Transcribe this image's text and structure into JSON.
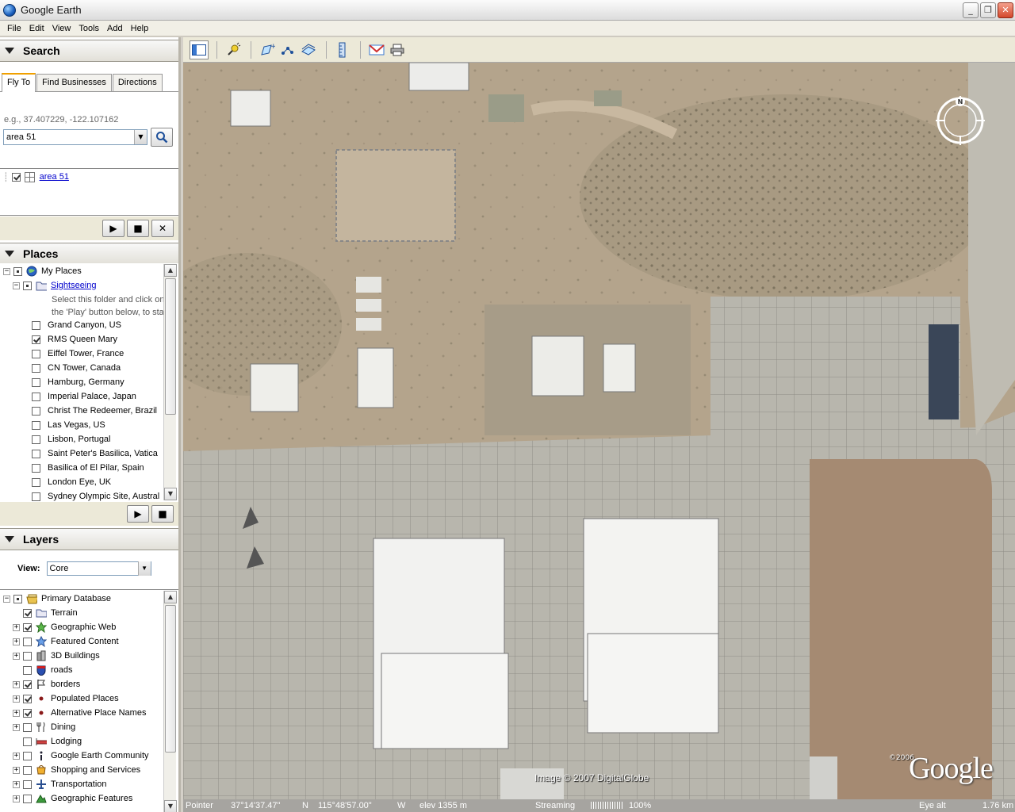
{
  "window": {
    "title": "Google Earth"
  },
  "menu": [
    "File",
    "Edit",
    "View",
    "Tools",
    "Add",
    "Help"
  ],
  "search": {
    "header": "Search",
    "tabs": [
      "Fly To",
      "Find Businesses",
      "Directions"
    ],
    "hint": "e.g., 37.407229, -122.107162",
    "query": "area 51",
    "result": "area 51"
  },
  "places": {
    "header": "Places",
    "root": "My Places",
    "folder": "Sightseeing",
    "folder_desc_1": "Select this folder and click on",
    "folder_desc_2": "the 'Play' button below, to sta",
    "items": [
      {
        "label": "Grand Canyon, US",
        "checked": false
      },
      {
        "label": "RMS Queen Mary",
        "checked": true
      },
      {
        "label": "Eiffel Tower, France",
        "checked": false
      },
      {
        "label": "CN Tower, Canada",
        "checked": false
      },
      {
        "label": "Hamburg, Germany",
        "checked": false
      },
      {
        "label": "Imperial Palace, Japan",
        "checked": false
      },
      {
        "label": "Christ The Redeemer, Brazil",
        "checked": false
      },
      {
        "label": "Las Vegas, US",
        "checked": false
      },
      {
        "label": "Lisbon, Portugal",
        "checked": false
      },
      {
        "label": "Saint Peter's Basilica, Vatica",
        "checked": false
      },
      {
        "label": "Basilica of El Pilar, Spain",
        "checked": false
      },
      {
        "label": "London Eye, UK",
        "checked": false
      },
      {
        "label": "Sydney Olympic Site, Austral",
        "checked": false
      }
    ]
  },
  "layers": {
    "header": "Layers",
    "view_label": "View:",
    "view_value": "Core",
    "root": "Primary Database",
    "items": [
      {
        "label": "Terrain",
        "checked": true,
        "expandable": false,
        "icon": "folder-icon"
      },
      {
        "label": "Geographic Web",
        "checked": true,
        "expandable": true,
        "icon": "globe-icon"
      },
      {
        "label": "Featured Content",
        "checked": false,
        "expandable": true,
        "icon": "star-icon"
      },
      {
        "label": "3D Buildings",
        "checked": false,
        "expandable": true,
        "icon": "building-icon"
      },
      {
        "label": "roads",
        "checked": false,
        "expandable": false,
        "icon": "road-shield-icon"
      },
      {
        "label": "borders",
        "checked": true,
        "expandable": true,
        "icon": "flag-icon"
      },
      {
        "label": "Populated Places",
        "checked": true,
        "expandable": true,
        "icon": "dot-icon"
      },
      {
        "label": "Alternative Place Names",
        "checked": true,
        "expandable": true,
        "icon": "dot-icon"
      },
      {
        "label": "Dining",
        "checked": false,
        "expandable": true,
        "icon": "fork-knife-icon"
      },
      {
        "label": "Lodging",
        "checked": false,
        "expandable": false,
        "icon": "bed-icon"
      },
      {
        "label": "Google Earth Community",
        "checked": false,
        "expandable": true,
        "icon": "info-icon"
      },
      {
        "label": "Shopping and Services",
        "checked": false,
        "expandable": true,
        "icon": "shop-icon"
      },
      {
        "label": "Transportation",
        "checked": false,
        "expandable": true,
        "icon": "plane-icon"
      },
      {
        "label": "Geographic Features",
        "checked": false,
        "expandable": true,
        "icon": "mountain-icon"
      }
    ]
  },
  "map": {
    "copyright": "Image © 2007 DigitalGlobe",
    "logo": "Google",
    "logo_year": "©2006"
  },
  "status": {
    "pointer_label": "Pointer",
    "lat": "37°14'37.47\"",
    "lat_dir": "N",
    "lon": "115°48'57.00\"",
    "lon_dir": "W",
    "elev": "elev 1355 m",
    "streaming_label": "Streaming",
    "streaming_pct": "100%",
    "eye_label": "Eye alt",
    "eye_value": "1.76 km"
  }
}
